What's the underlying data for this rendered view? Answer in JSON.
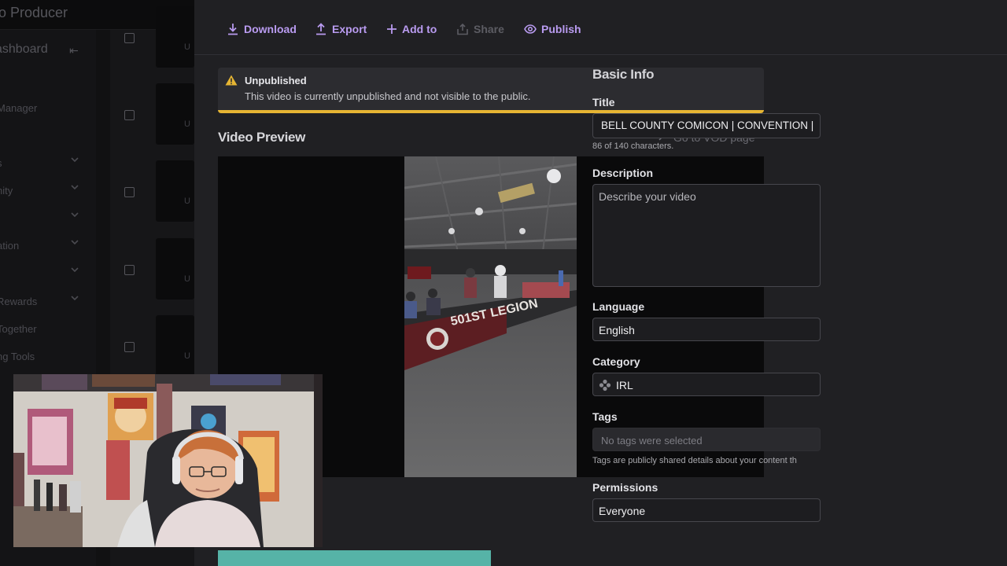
{
  "background": {
    "app_title": "o Producer",
    "dashboard_title": "ashboard",
    "nav_items": [
      {
        "label": "Manager",
        "chevron": false
      },
      {
        "label": "s",
        "chevron": true
      },
      {
        "label": "nity",
        "chevron": true
      },
      {
        "label": "",
        "chevron": true
      },
      {
        "label": "ation",
        "chevron": true
      },
      {
        "label": "",
        "chevron": true
      },
      {
        "label": "Rewards",
        "chevron": true
      },
      {
        "label": "Together",
        "chevron": false
      },
      {
        "label": "ng Tools",
        "chevron": false
      }
    ],
    "row_status_fragment": "U"
  },
  "toolbar": {
    "download": "Download",
    "export": "Export",
    "add_to": "Add to",
    "share": "Share",
    "publish": "Publish",
    "accent_color": "#b99bf0"
  },
  "notice": {
    "title": "Unpublished",
    "message": "This video is currently unpublished and not visible to the public.",
    "accent_color": "#e6b533"
  },
  "preview": {
    "heading": "Video Preview",
    "vod_link": "Go to VOD page",
    "banner_text": "501ST LEGION"
  },
  "form": {
    "section_title": "Basic Info",
    "title_label": "Title",
    "title_value": "BELL COUNTY COMICON | CONVENTION |",
    "title_char_count": "86 of 140 characters.",
    "description_label": "Description",
    "description_placeholder": "Describe your video",
    "language_label": "Language",
    "language_value": "English",
    "category_label": "Category",
    "category_value": "IRL",
    "tags_label": "Tags",
    "tags_placeholder": "No tags were selected",
    "tags_hint": "Tags are publicly shared details about your content th",
    "permissions_label": "Permissions",
    "permissions_value": "Everyone"
  }
}
